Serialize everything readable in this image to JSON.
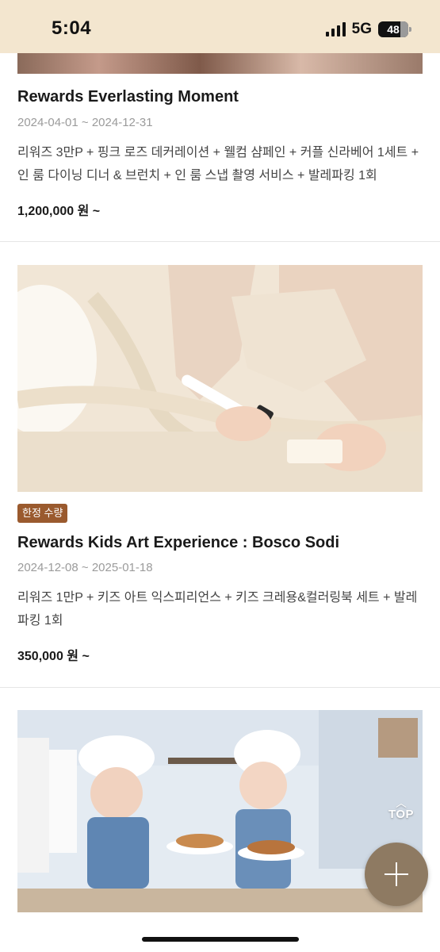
{
  "status_bar": {
    "time": "5:04",
    "network": "5G",
    "battery": "48"
  },
  "offers": [
    {
      "title": "Rewards Everlasting Moment",
      "date": "2024-04-01 ~ 2024-12-31",
      "description": "리워즈 3만P + 핑크 로즈 데커레이션 + 웰컴 샴페인 + 커플 신라베어 1세트 + 인 룸 다이닝 디너 & 브런치 + 인 룸 스냅 촬영 서비스 + 발레파킹 1회",
      "price": "1,200,000 원 ~"
    },
    {
      "badge": "한정 수량",
      "title": "Rewards Kids Art Experience : Bosco Sodi",
      "date": "2024-12-08 ~ 2025-01-18",
      "description": "리워즈 1만P + 키즈 아트 익스피리언스 + 키즈 크레용&컬러링북 세트 + 발레파킹 1회",
      "price": "350,000 원 ~"
    }
  ],
  "top_button": {
    "label": "TOP",
    "icon": "chevron-up-icon"
  },
  "fab": {
    "icon": "plus-icon"
  },
  "colors": {
    "status_bar_bg": "#f3e6cf",
    "badge_bg": "#9a5a2e",
    "fab_bg": "#8e7a62",
    "date_text": "#9b9b9b"
  }
}
